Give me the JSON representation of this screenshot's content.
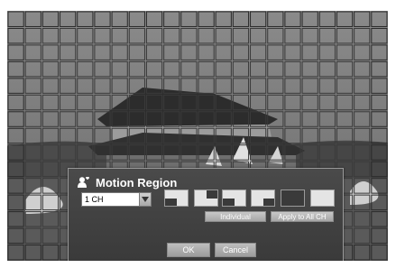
{
  "dialog": {
    "title": "Motion Region",
    "channel_select": {
      "value": "1 CH"
    },
    "region_buttons": [
      {
        "name": "region-bottom-left-button"
      },
      {
        "name": "region-top-right-button"
      },
      {
        "name": "region-bottom-right-button"
      },
      {
        "name": "region-bottom-left-half-button"
      },
      {
        "name": "region-full-button"
      },
      {
        "name": "region-clear-button"
      }
    ],
    "individual_label": "Individual",
    "apply_all_label": "Apply to All CH",
    "ok_label": "OK",
    "cancel_label": "Cancel"
  },
  "colors": {
    "dialog_bg": "#404040",
    "grid_line": "#2e2e2e",
    "button_face": "#b0b0b0"
  },
  "icons": [
    "user-icon",
    "chevron-down-icon"
  ]
}
